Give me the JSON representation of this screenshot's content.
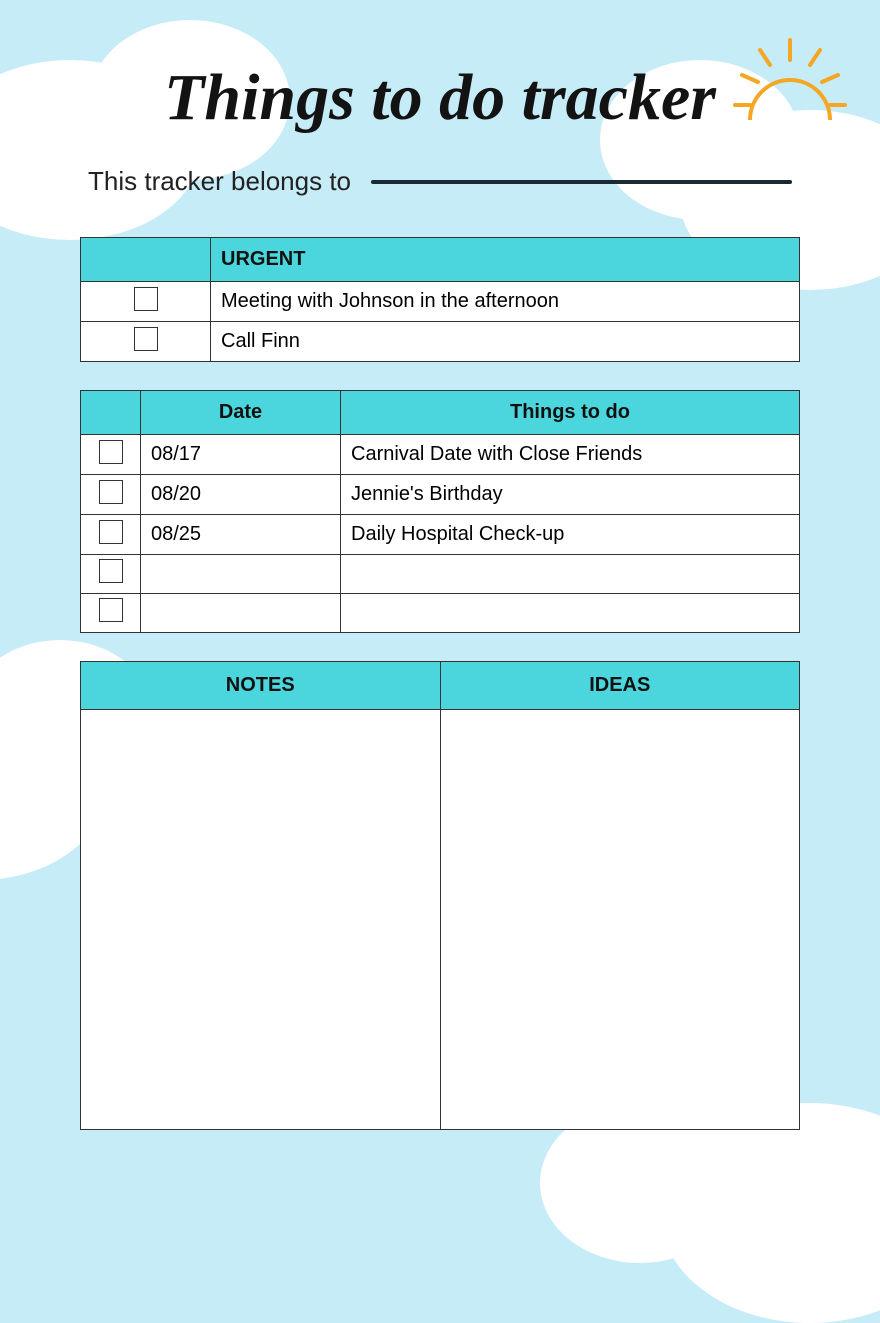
{
  "title": "Things to do tracker",
  "belongs_label": "This tracker belongs to",
  "urgent": {
    "header": "URGENT",
    "items": [
      {
        "text": "Meeting with Johnson in the afternoon"
      },
      {
        "text": "Call Finn"
      }
    ]
  },
  "todo": {
    "date_header": "Date",
    "things_header": "Things to do",
    "rows": [
      {
        "date": "08/17",
        "task": "Carnival Date with Close Friends"
      },
      {
        "date": "08/20",
        "task": "Jennie's Birthday"
      },
      {
        "date": "08/25",
        "task": "Daily Hospital Check-up"
      },
      {
        "date": "",
        "task": ""
      },
      {
        "date": "",
        "task": ""
      }
    ]
  },
  "notes_header": "NOTES",
  "ideas_header": "IDEAS"
}
